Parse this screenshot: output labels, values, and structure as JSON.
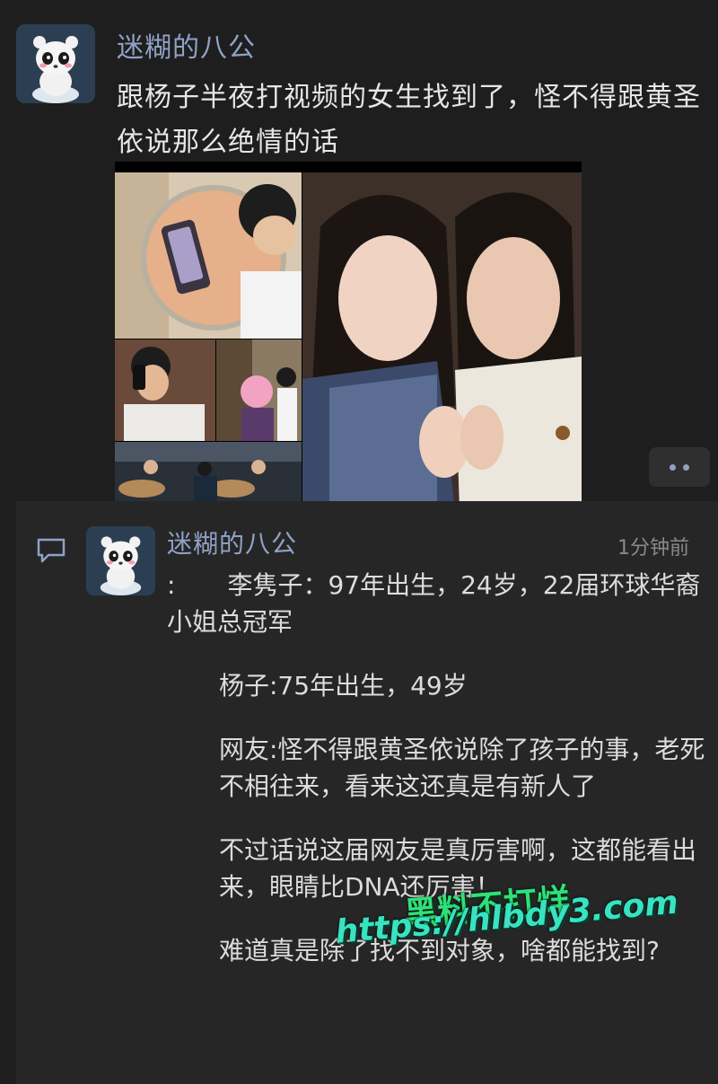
{
  "post": {
    "author": "迷糊的八公",
    "text": "跟杨子半夜打视频的女生找到了，怪不得跟黄圣依说那么绝情的话",
    "avatar_icon": "panda-avatar-icon",
    "photos": [
      "phone-call-closeup",
      "man-on-phone",
      "blurred-couple",
      "restaurant-scene",
      "two-women-selfie"
    ]
  },
  "more_button": {
    "icon": "more-dots-icon"
  },
  "comment": {
    "icon": "comment-bubble-icon",
    "author": "迷糊的八公",
    "time": "1分钟前",
    "prefix": ":",
    "p1": "李隽子：97年出生，24岁，22届环球华裔小姐总冠军",
    "p2": "杨子:75年出生，49岁",
    "p3": "网友:怪不得跟黄圣依说除了孩子的事，老死不相往来，看来这还真是有新人了",
    "p4": "不过话说这届网友是真厉害啊，这都能看出来，眼睛比DNA还厉害！",
    "p5": "难道真是除了找不到对象，啥都能找到?"
  },
  "watermark": {
    "brand": "黑料不打烊",
    "url": "https://hlbdy3.com"
  },
  "colors": {
    "background": "#1e1e1e",
    "author_link": "#8fa2c6",
    "watermark_green": "#2fe07a"
  }
}
